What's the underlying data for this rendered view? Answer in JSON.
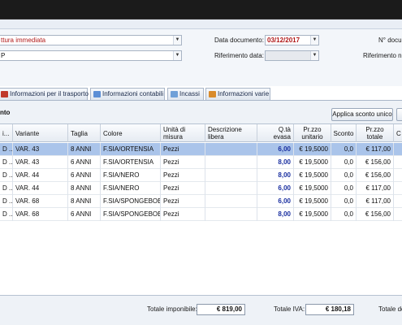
{
  "header": {
    "document_type_value": "ttura immediata",
    "second_combo_value": "P",
    "data_documento_label": "Data documento:",
    "data_documento_value": "03/12/2017",
    "riferimento_data_label": "Riferimento data:",
    "num_doc_label": "N° docum",
    "riferimento_num_label": "Riferimento nu"
  },
  "tabs": [
    {
      "label": "Informazioni per il trasporto"
    },
    {
      "label": "Informazioni contabili"
    },
    {
      "label": "Incassi"
    },
    {
      "label": "Informazioni varie"
    }
  ],
  "section": {
    "title": "nto",
    "apply_discount_label": "Applica sconto unico"
  },
  "table": {
    "headers": {
      "code": "i...",
      "variante": "Variante",
      "taglia": "Taglia",
      "colore": "Colore",
      "um": "Unità di misura",
      "desc": "Descrizione libera",
      "qta": "Q.tà evasa",
      "prezzo": "Pr.zzo unitario",
      "sconto": "Sconto",
      "totale": "Pr.zzo totale",
      "extra": "C"
    },
    "rows": [
      {
        "code": "D ...",
        "variante": "VAR. 43",
        "taglia": "8 ANNI",
        "colore": "F.SIA/ORTENSIA",
        "um": "Pezzi",
        "desc": "",
        "qta": "6,00",
        "prezzo": "€ 19,5000",
        "sconto": "0,0",
        "totale": "€ 117,00"
      },
      {
        "code": "D ...",
        "variante": "VAR. 43",
        "taglia": "6 ANNI",
        "colore": "F.SIA/ORTENSIA",
        "um": "Pezzi",
        "desc": "",
        "qta": "8,00",
        "prezzo": "€ 19,5000",
        "sconto": "0,0",
        "totale": "€ 156,00"
      },
      {
        "code": "D ...",
        "variante": "VAR. 44",
        "taglia": "6 ANNI",
        "colore": "F.SIA/NERO",
        "um": "Pezzi",
        "desc": "",
        "qta": "8,00",
        "prezzo": "€ 19,5000",
        "sconto": "0,0",
        "totale": "€ 156,00"
      },
      {
        "code": "D ...",
        "variante": "VAR. 44",
        "taglia": "8 ANNI",
        "colore": "F.SIA/NERO",
        "um": "Pezzi",
        "desc": "",
        "qta": "6,00",
        "prezzo": "€ 19,5000",
        "sconto": "0,0",
        "totale": "€ 117,00"
      },
      {
        "code": "D ...",
        "variante": "VAR. 68",
        "taglia": "8 ANNI",
        "colore": "F.SIA/SPONGEBOB",
        "um": "Pezzi",
        "desc": "",
        "qta": "6,00",
        "prezzo": "€ 19,5000",
        "sconto": "0,0",
        "totale": "€ 117,00"
      },
      {
        "code": "D ...",
        "variante": "VAR. 68",
        "taglia": "6 ANNI",
        "colore": "F.SIA/SPONGEBOB",
        "um": "Pezzi",
        "desc": "",
        "qta": "8,00",
        "prezzo": "€ 19,5000",
        "sconto": "0,0",
        "totale": "€ 156,00"
      }
    ]
  },
  "footer": {
    "imponibile_label": "Totale imponibile:",
    "imponibile_value": "€ 819,00",
    "iva_label": "Totale IVA:",
    "iva_value": "€ 180,18",
    "totale_label": "Totale do"
  },
  "colors": {
    "selected_row": "#aac4ea",
    "accent_red": "#b01818",
    "qty_blue": "#1a2fa0"
  }
}
